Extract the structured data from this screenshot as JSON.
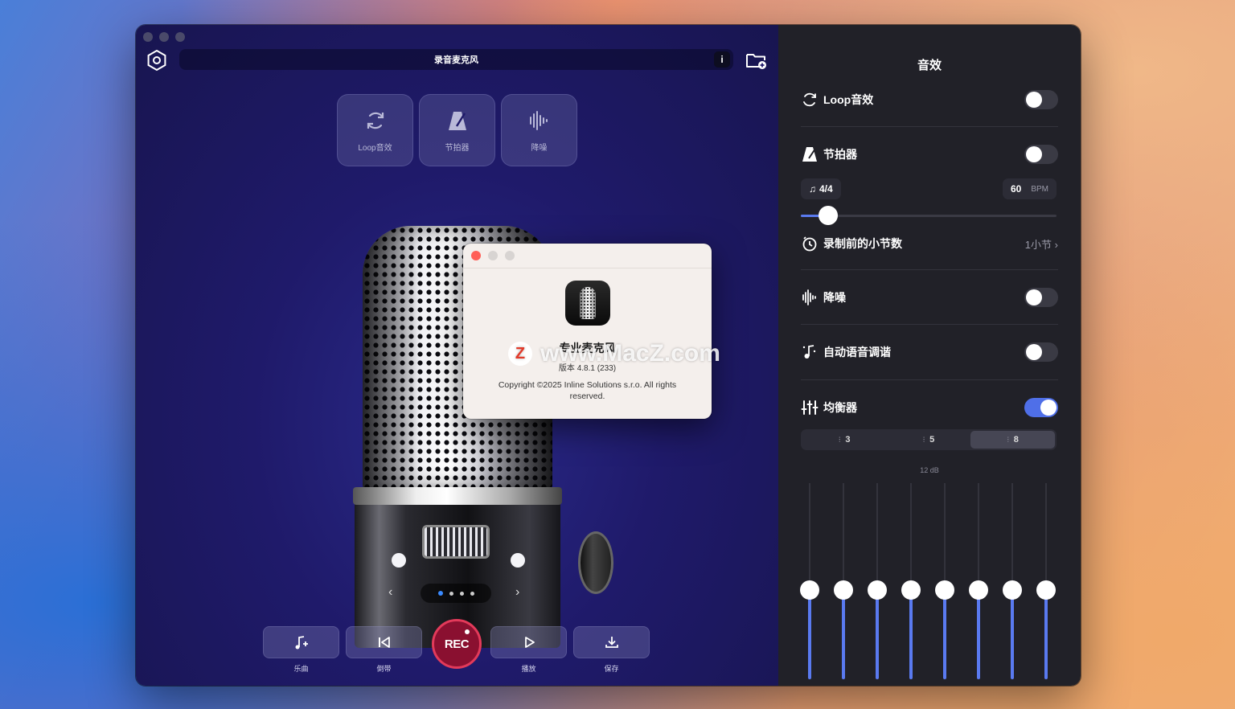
{
  "window": {
    "title": "录音麦克风",
    "info_label": "i"
  },
  "effects_tiles": [
    {
      "label": "Loop音效",
      "icon": "loop-icon"
    },
    {
      "label": "节拍器",
      "icon": "metronome-icon"
    },
    {
      "label": "降噪",
      "icon": "waveform-icon"
    }
  ],
  "toolbar": {
    "music_label": "乐曲",
    "rewind_label": "倒带",
    "rec_label": "REC",
    "play_label": "播放",
    "save_label": "保存"
  },
  "about": {
    "app_name": "专业麦克风",
    "version": "版本 4.8.1 (233)",
    "copyright": "Copyright ©2025 Inline Solutions s.r.o. All rights reserved."
  },
  "watermark": {
    "logo": "Z",
    "text": "www.MacZ.com"
  },
  "sidebar": {
    "title": "音效",
    "loop": {
      "label": "Loop音效",
      "on": false
    },
    "metronome": {
      "label": "节拍器",
      "on": false,
      "time_signature": "4/4",
      "bpm": "60",
      "bpm_unit": "BPM",
      "tempo_fraction": 0.08
    },
    "count_in": {
      "label": "录制前的小节数",
      "value": "1小节"
    },
    "noise": {
      "label": "降噪",
      "on": false
    },
    "autotune": {
      "label": "自动语音调谐",
      "on": false
    },
    "equalizer": {
      "label": "均衡器",
      "on": true,
      "bands_options": [
        "3",
        "5",
        "8"
      ],
      "selected": "8",
      "db_label": "12 dB",
      "band_levels": [
        0.45,
        0.45,
        0.45,
        0.45,
        0.45,
        0.45,
        0.45,
        0.45
      ]
    }
  },
  "colors": {
    "accent": "#4f6fe8",
    "rec": "#e33a5a",
    "sidebar_bg": "#212128",
    "main_bg": "#1f1a6a"
  }
}
